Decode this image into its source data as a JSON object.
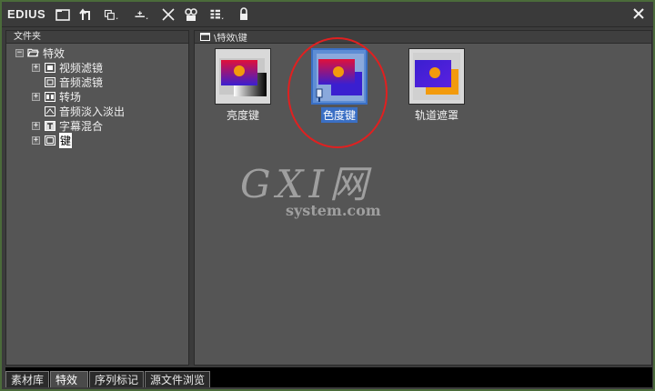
{
  "app": {
    "title": "EDIUS"
  },
  "toolbar": {
    "icons": [
      "folder-icon",
      "up-folder-icon",
      "copy-icon",
      "add-icon",
      "delete-icon",
      "properties-icon",
      "view-icon",
      "lock-icon",
      "close-icon"
    ]
  },
  "left_panel": {
    "header": "文件夹",
    "tree": [
      {
        "label": "特效",
        "expander": "−",
        "icon": "folder-open-icon"
      },
      {
        "label": "视频滤镜",
        "expander": "+",
        "icon": "video-filter-icon"
      },
      {
        "label": "音频滤镜",
        "expander": "",
        "icon": "audio-filter-icon"
      },
      {
        "label": "转场",
        "expander": "+",
        "icon": "transition-icon"
      },
      {
        "label": "音频淡入淡出",
        "expander": "",
        "icon": "audio-fade-icon"
      },
      {
        "label": "字幕混合",
        "expander": "+",
        "icon": "title-mix-icon"
      },
      {
        "label": "键",
        "expander": "+",
        "icon": "key-icon"
      }
    ]
  },
  "right_panel": {
    "path": "\\特效\\键",
    "items": [
      {
        "label": "亮度键"
      },
      {
        "label": "色度键"
      },
      {
        "label": "轨道遮罩"
      }
    ]
  },
  "watermark": {
    "brand": "GXI网",
    "domain": "system.com"
  },
  "bottom_tabs": [
    "素材库",
    "特效",
    "序列标记",
    "源文件浏览"
  ],
  "colors": {
    "selection": "#3a6fc4",
    "highlight_circle": "#e02020",
    "window_border": "#4b6b3a"
  }
}
